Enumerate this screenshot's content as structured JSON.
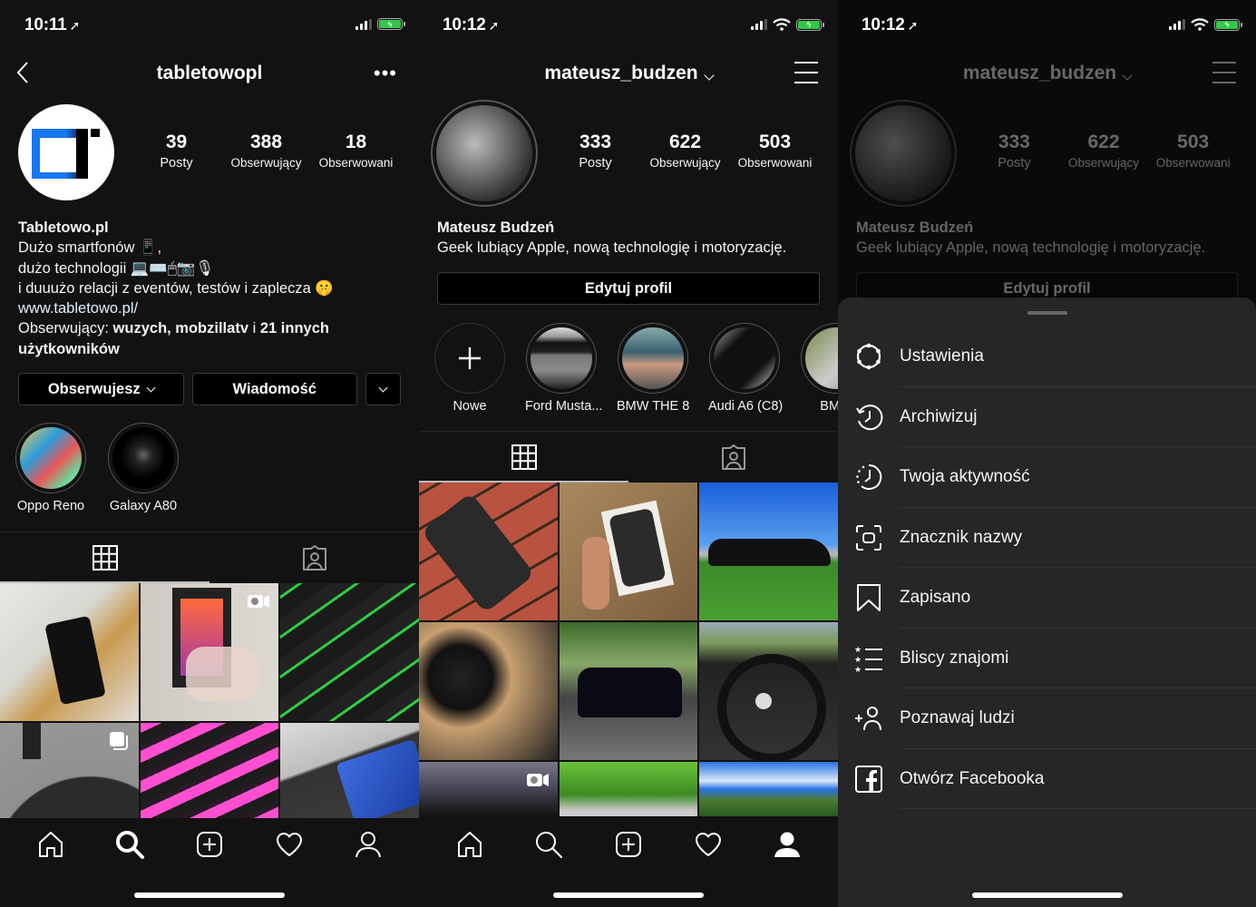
{
  "panels": [
    {
      "status_bar": {
        "time": "10:11",
        "location_icon": "location-arrow-icon",
        "wifi": false
      },
      "nav": {
        "title": "tabletowopl",
        "back_icon": "chevron-left-icon",
        "more_icon": "more-horizontal-icon"
      },
      "profile": {
        "stats": [
          {
            "value": "39",
            "label": "Posty"
          },
          {
            "value": "388",
            "label": "Obserwujący"
          },
          {
            "value": "18",
            "label": "Obserwowani"
          }
        ],
        "bio": {
          "name": "Tabletowo.pl",
          "line1": "Dużo smartfonów 📱,",
          "line2": "dużo technologii 💻⌨️🖱📷🎙",
          "line3": "i duuużo relacji z eventów, testów i zaplecza 🤫",
          "link": "www.tabletowo.pl/",
          "followed_prefix": "Obserwujący: ",
          "followed_names": "wuzych, mobzillatv",
          "followed_mid": " i ",
          "followed_rest": "21 innych użytkowników"
        },
        "buttons": {
          "follow": "Obserwujesz",
          "message": "Wiadomość"
        }
      },
      "highlights": [
        {
          "label": "Oppo Reno"
        },
        {
          "label": "Galaxy A80"
        }
      ],
      "tabs": [
        {
          "icon": "grid-icon",
          "active": true
        },
        {
          "icon": "tagged-icon",
          "active": false
        }
      ],
      "grid": [
        {
          "desc": "phone on wooden block with clapperboard",
          "badge": null
        },
        {
          "desc": "phone box unboxing",
          "badge": "igtv-icon"
        },
        {
          "desc": "green backlit keyboard",
          "badge": null
        },
        {
          "desc": "black headset PLT",
          "badge": "carousel-icon"
        },
        {
          "desc": "pink RGB RAM modules",
          "badge": null
        },
        {
          "desc": "phone on tabletowo box",
          "badge": null
        }
      ]
    },
    {
      "status_bar": {
        "time": "10:12",
        "location_icon": "location-arrow-icon",
        "wifi": true
      },
      "nav": {
        "title": "mateusz_budzen",
        "menu_icon": "hamburger-menu-icon"
      },
      "profile": {
        "stats": [
          {
            "value": "333",
            "label": "Posty"
          },
          {
            "value": "622",
            "label": "Obserwujący"
          },
          {
            "value": "503",
            "label": "Obserwowani"
          }
        ],
        "bio": {
          "name": "Mateusz Budzeń",
          "text": "Geek lubiący Apple, nową technologię i motoryzację."
        },
        "buttons": {
          "edit": "Edytuj profil"
        }
      },
      "highlights": [
        {
          "label": "Nowe"
        },
        {
          "label": "Ford Musta..."
        },
        {
          "label": "BMW THE 8"
        },
        {
          "label": "Audi A6 (C8)"
        },
        {
          "label": "BMW"
        }
      ],
      "tabs": [
        {
          "icon": "grid-icon",
          "active": true
        },
        {
          "icon": "tagged-icon",
          "active": false
        }
      ],
      "grid": [
        {
          "desc": "iPhone 11 on red bench",
          "badge": null
        },
        {
          "desc": "iPhone 11 box in hand",
          "badge": null
        },
        {
          "desc": "black BMW coupe on grass",
          "badge": null
        },
        {
          "desc": "BMW M gear knob",
          "badge": null
        },
        {
          "desc": "black BMW in street",
          "badge": null
        },
        {
          "desc": "BMW steering wheel",
          "badge": null
        },
        {
          "desc": "dashboard road view",
          "badge": "igtv-icon"
        },
        {
          "desc": "apple watch over grass",
          "badge": null
        },
        {
          "desc": "cornfield and sky",
          "badge": null
        }
      ]
    },
    {
      "status_bar": {
        "time": "10:12",
        "location_icon": "location-arrow-icon",
        "wifi": true
      },
      "menu": [
        {
          "icon": "settings-icon",
          "label": "Ustawienia"
        },
        {
          "icon": "archive-icon",
          "label": "Archiwizuj"
        },
        {
          "icon": "activity-icon",
          "label": "Twoja aktywność"
        },
        {
          "icon": "nametag-icon",
          "label": "Znacznik nazwy"
        },
        {
          "icon": "bookmark-icon",
          "label": "Zapisano"
        },
        {
          "icon": "close-friends-icon",
          "label": "Bliscy znajomi"
        },
        {
          "icon": "add-person-icon",
          "label": "Poznawaj ludzi"
        },
        {
          "icon": "facebook-icon",
          "label": "Otwórz Facebooka"
        }
      ]
    }
  ],
  "tabbar": [
    "home-icon",
    "search-icon",
    "add-post-icon",
    "heart-icon",
    "profile-icon"
  ],
  "colors": {
    "background": "#121212",
    "sheet": "#262626",
    "battery": "#33c748",
    "link": "#e0f1ff"
  }
}
